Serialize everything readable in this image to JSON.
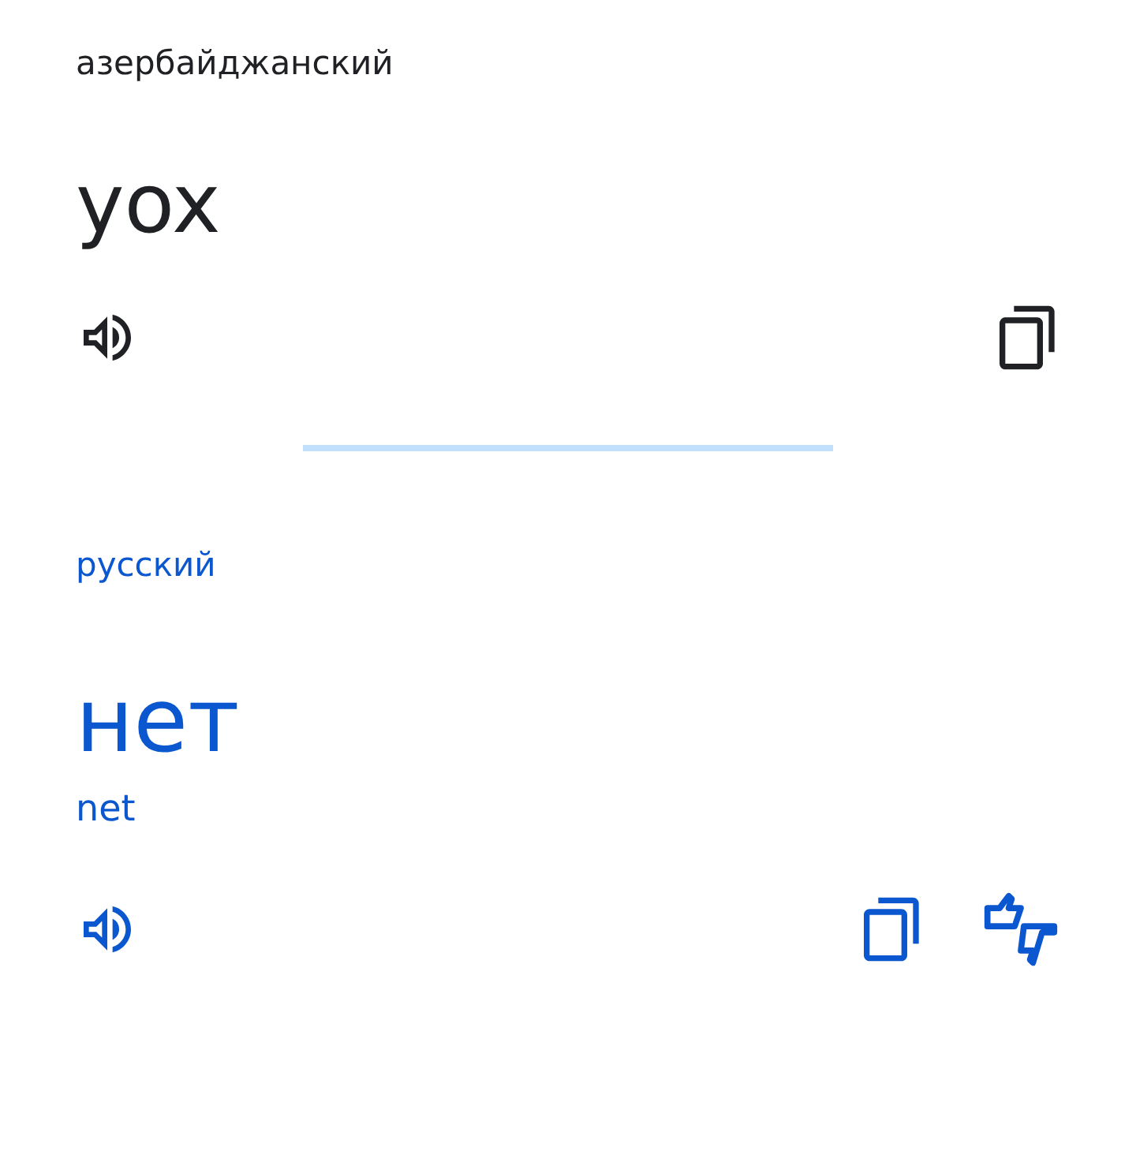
{
  "source": {
    "language": "азербайджанский",
    "text": "yox"
  },
  "target": {
    "language": "русский",
    "text": "нет",
    "transliteration": "net"
  }
}
